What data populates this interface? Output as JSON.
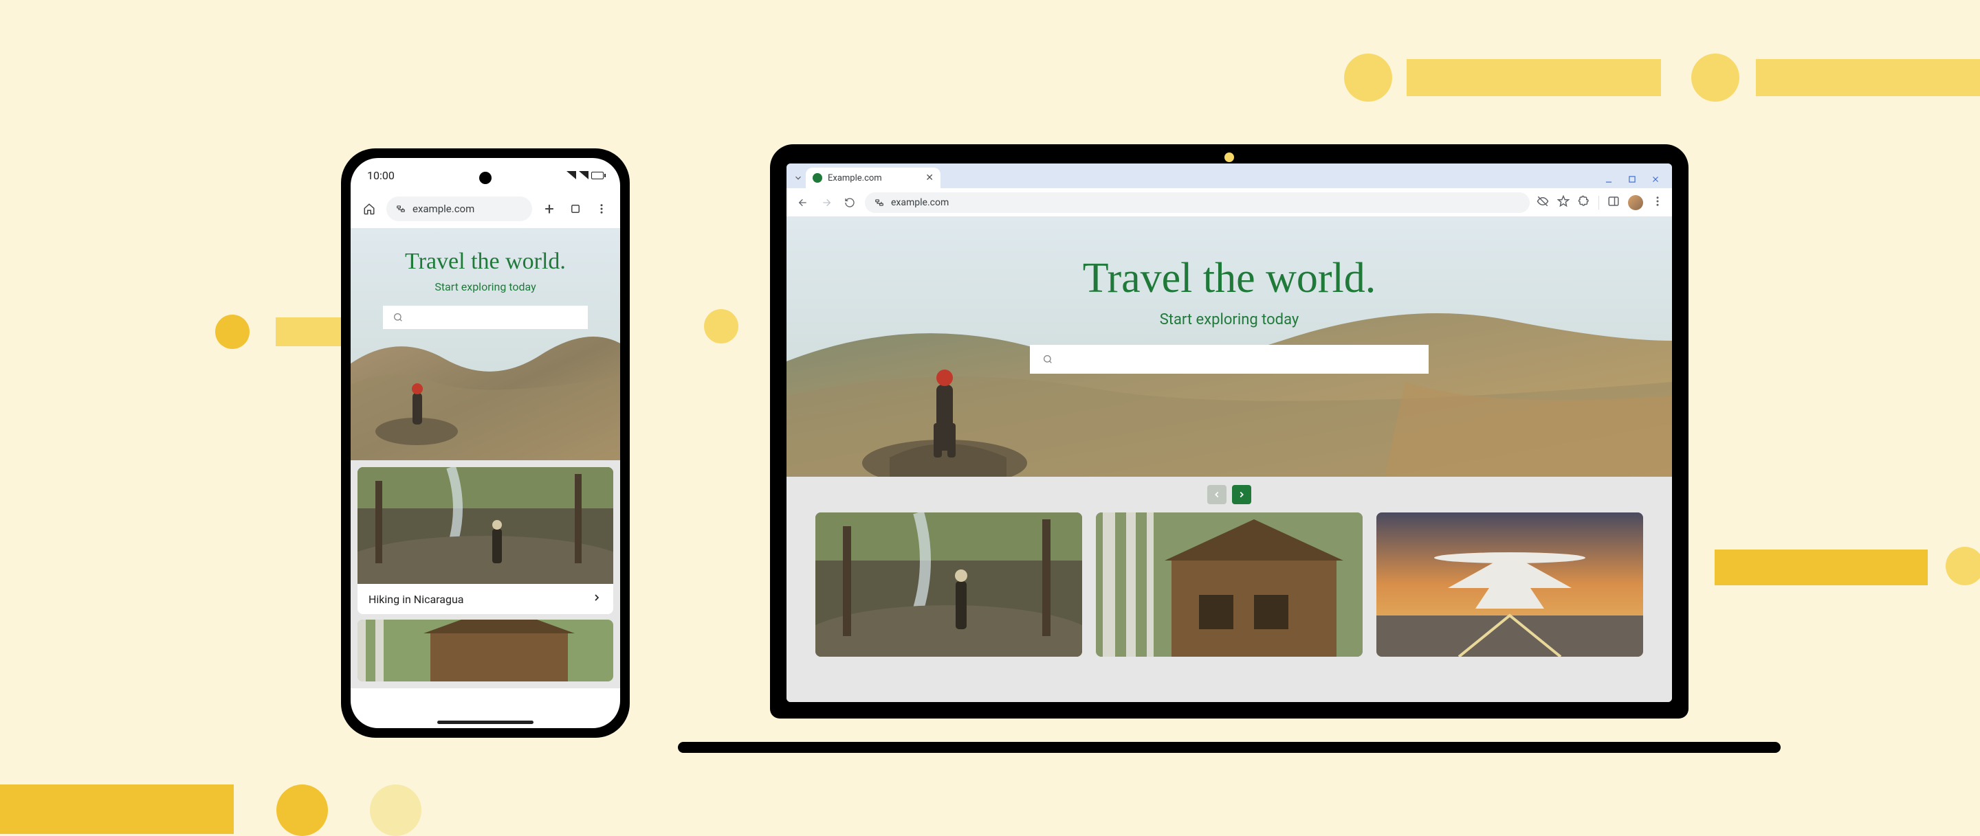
{
  "phone": {
    "status": {
      "time": "10:00"
    },
    "url": "example.com",
    "hero": {
      "title": "Travel the world.",
      "subtitle": "Start exploring today"
    },
    "card1_title": "Hiking in Nicaragua"
  },
  "laptop": {
    "tab_label": "Example.com",
    "url": "example.com",
    "hero": {
      "title": "Travel the world.",
      "subtitle": "Start exploring today"
    }
  }
}
